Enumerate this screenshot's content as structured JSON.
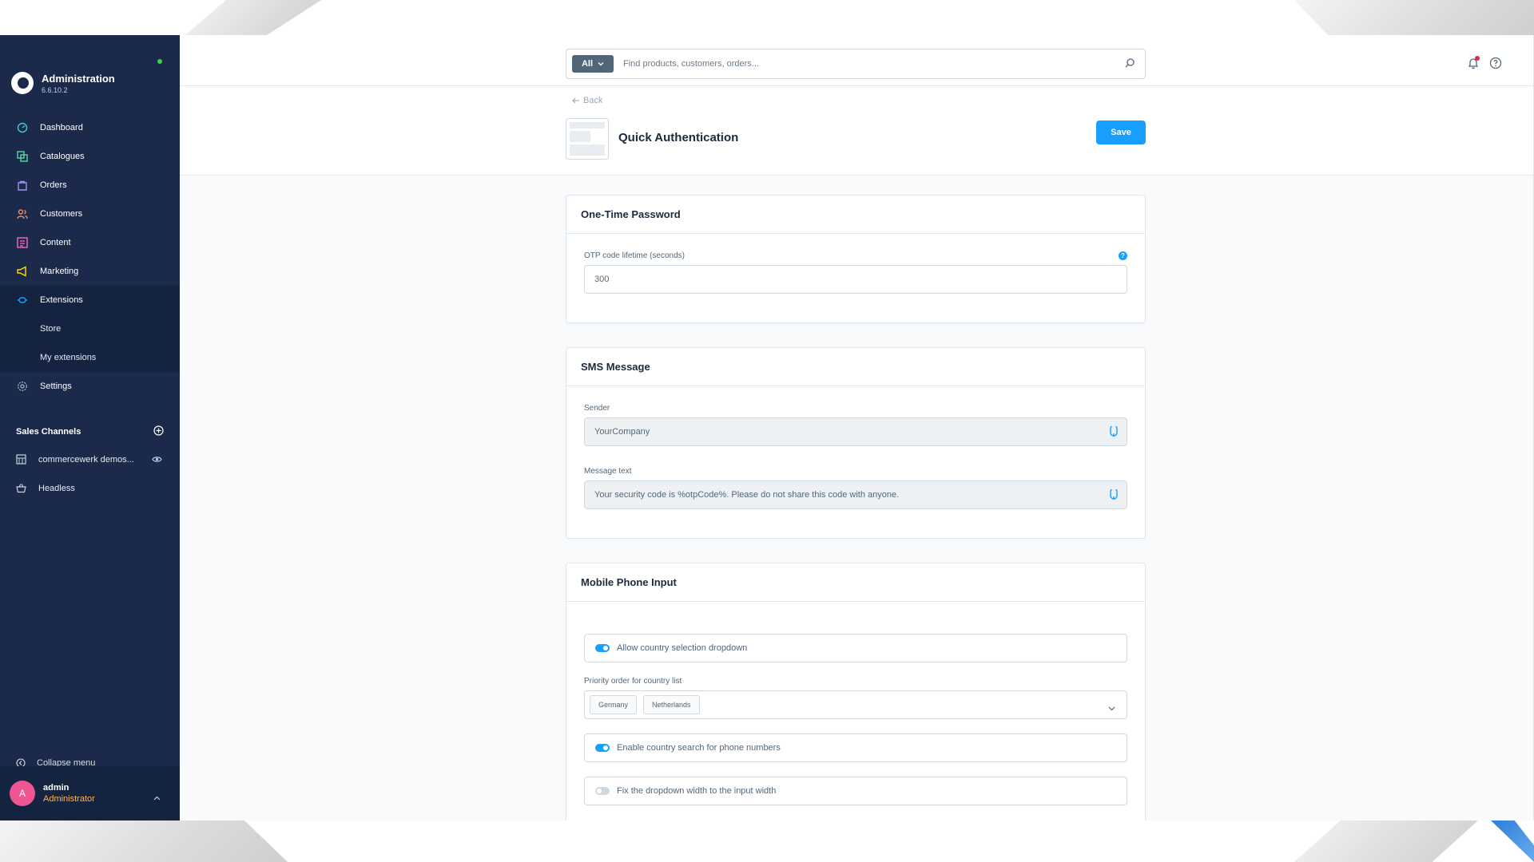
{
  "sidebar": {
    "title": "Administration",
    "version": "6.6.10.2",
    "nav": [
      {
        "label": "Dashboard",
        "icon": "dashboard-icon",
        "color": "#4cc3d9"
      },
      {
        "label": "Catalogues",
        "icon": "catalogues-icon",
        "color": "#57d9a3"
      },
      {
        "label": "Orders",
        "icon": "orders-icon",
        "color": "#a092f0"
      },
      {
        "label": "Customers",
        "icon": "customers-icon",
        "color": "#f88962"
      },
      {
        "label": "Content",
        "icon": "content-icon",
        "color": "#ff68b4"
      },
      {
        "label": "Marketing",
        "icon": "marketing-icon",
        "color": "#ffd700"
      },
      {
        "label": "Extensions",
        "icon": "extensions-icon",
        "color": "#189eff"
      },
      {
        "label": "Settings",
        "icon": "settings-icon",
        "color": "#9aa8b5"
      }
    ],
    "extensions_sub": [
      "Store",
      "My extensions"
    ],
    "sales_channels_title": "Sales Channels",
    "sales_channels": [
      "commercewerk demos...",
      "Headless"
    ],
    "collapse_label": "Collapse menu",
    "user": {
      "initial": "A",
      "name": "admin",
      "role": "Administrator"
    }
  },
  "search": {
    "type": "All",
    "placeholder": "Find products, customers, orders..."
  },
  "smartbar": {
    "back": "Back",
    "title": "Quick Authentication",
    "save": "Save"
  },
  "cards": {
    "otp": {
      "title": "One-Time Password",
      "lifetime_label": "OTP code lifetime (seconds)",
      "lifetime_value": "300"
    },
    "sms": {
      "title": "SMS Message",
      "sender_label": "Sender",
      "sender_value": "YourCompany",
      "message_label": "Message text",
      "message_value": "Your security code is %otpCode%. Please do not share this code with anyone."
    },
    "phone": {
      "title": "Mobile Phone Input",
      "toggle_country": "Allow country selection dropdown",
      "priority_label": "Priority order for country list",
      "priority_countries": [
        "Germany",
        "Netherlands"
      ],
      "toggle_search": "Enable country search for phone numbers",
      "toggle_width": "Fix the dropdown width to the input width"
    }
  },
  "colors": {
    "sidebar_bg": "#1b2a4b",
    "primary": "#189eff",
    "status_online": "#37d046"
  }
}
